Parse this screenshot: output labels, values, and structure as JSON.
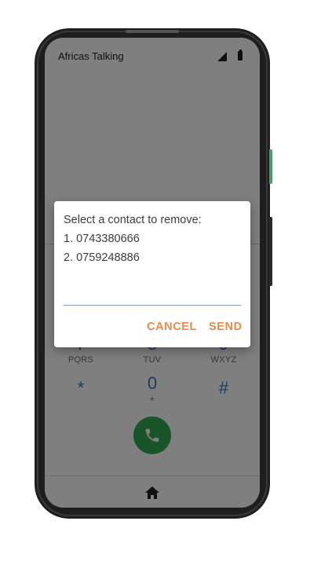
{
  "app": {
    "title": "Africas Talking"
  },
  "dialpad": {
    "keys": [
      {
        "digit": "7",
        "letters": "PQRS"
      },
      {
        "digit": "8",
        "letters": "TUV"
      },
      {
        "digit": "9",
        "letters": "WXYZ"
      },
      {
        "digit": "*",
        "letters": ""
      },
      {
        "digit": "0",
        "letters": "+"
      },
      {
        "digit": "#",
        "letters": ""
      }
    ]
  },
  "dialog": {
    "message_title": "Select a contact to remove:",
    "options": [
      "1. 0743380666",
      "2. 0759248886"
    ],
    "input_value": "",
    "cancel_label": "CANCEL",
    "send_label": "SEND"
  },
  "colors": {
    "accent": "#e88a4a",
    "call": "#34a853",
    "dialpad_digit": "#3f73b8"
  },
  "icons": {
    "call": "phone-icon",
    "home": "home-icon",
    "signal": "signal-icon",
    "battery": "battery-icon"
  }
}
